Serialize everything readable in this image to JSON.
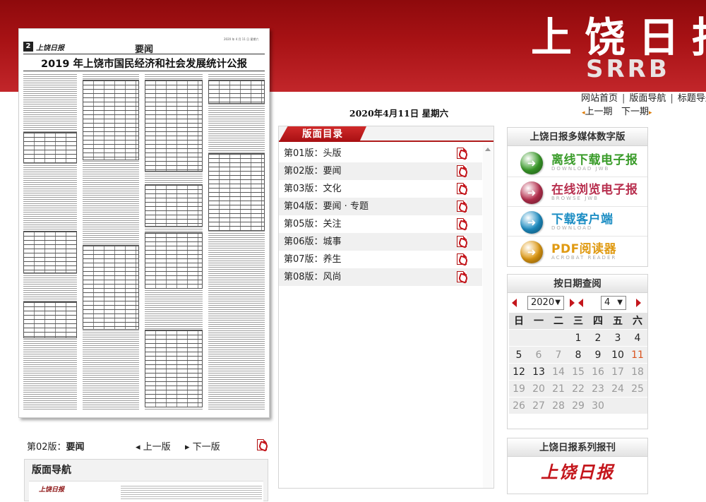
{
  "banner": {
    "brand_cn": "上饶日报",
    "brand_en": "SRRB"
  },
  "top_links": {
    "home": "网站首页",
    "sep": "|",
    "page_nav": "版面导航",
    "title_nav": "标题导航"
  },
  "issue_nav": {
    "prev": "上一期",
    "next": "下一期"
  },
  "date_line": "2020年4月11日 星期六",
  "newspaper": {
    "page_no": "2",
    "logo": "上饶日报",
    "section": "要闻",
    "headline": "2019 年上饶市国民经济和社会发展统计公报",
    "date_small": "2020 年 4 月 11 日 星期六"
  },
  "page_bar": {
    "current_prefix": "第02版：",
    "current_name": "要闻",
    "prev": "上一版",
    "next": "下一版"
  },
  "layout_nav": {
    "title": "版面导航",
    "thumb_logo": "上饶日报"
  },
  "toc": {
    "title": "版面目录",
    "items": [
      {
        "label": "第01版：头版"
      },
      {
        "label": "第02版：要闻"
      },
      {
        "label": "第03版：文化"
      },
      {
        "label": "第04版：要闻 · 专题"
      },
      {
        "label": "第05版：关注"
      },
      {
        "label": "第06版：城事"
      },
      {
        "label": "第07版：养生"
      },
      {
        "label": "第08版：风尚"
      }
    ]
  },
  "media": {
    "title": "上饶日报多媒体数字版",
    "buttons": [
      {
        "label": "离线下载电子报",
        "sub": "DOWNLOAD JWB",
        "icon": "download-arrow-icon",
        "color": "#3a9c2a"
      },
      {
        "label": "在线浏览电子报",
        "sub": "BROWSE JWB",
        "icon": "browse-arrow-icon",
        "color": "#b8304f"
      },
      {
        "label": "下载客户端",
        "sub": "DOWNLOAD",
        "icon": "client-arrow-icon",
        "color": "#1d8ec4"
      },
      {
        "label": "PDF阅读器",
        "sub": "ACROBAT READER",
        "icon": "reader-arrow-icon",
        "color": "#e09a12"
      }
    ]
  },
  "calendar": {
    "title": "按日期查阅",
    "year": "2020",
    "month": "4",
    "weekdays": [
      "日",
      "一",
      "二",
      "三",
      "四",
      "五",
      "六"
    ],
    "weeks": [
      [
        "",
        "",
        "",
        "1",
        "2",
        "3",
        "4"
      ],
      [
        "5",
        "6",
        "7",
        "8",
        "9",
        "10",
        "11"
      ],
      [
        "12",
        "13",
        "14",
        "15",
        "16",
        "17",
        "18"
      ],
      [
        "19",
        "20",
        "21",
        "22",
        "23",
        "24",
        "25"
      ],
      [
        "26",
        "27",
        "28",
        "29",
        "30",
        "",
        ""
      ]
    ],
    "grey_days": [
      "6",
      "7",
      "14",
      "15",
      "16",
      "17",
      "18",
      "19",
      "20",
      "21",
      "22",
      "23",
      "24",
      "25",
      "26",
      "27",
      "28",
      "29",
      "30"
    ],
    "today": "11"
  },
  "series": {
    "title": "上饶日报系列报刊",
    "logo": "上饶日报"
  },
  "colors": {
    "brand_red": "#a81215",
    "accent_orange": "#e07b00",
    "today_color": "#d9531e"
  }
}
